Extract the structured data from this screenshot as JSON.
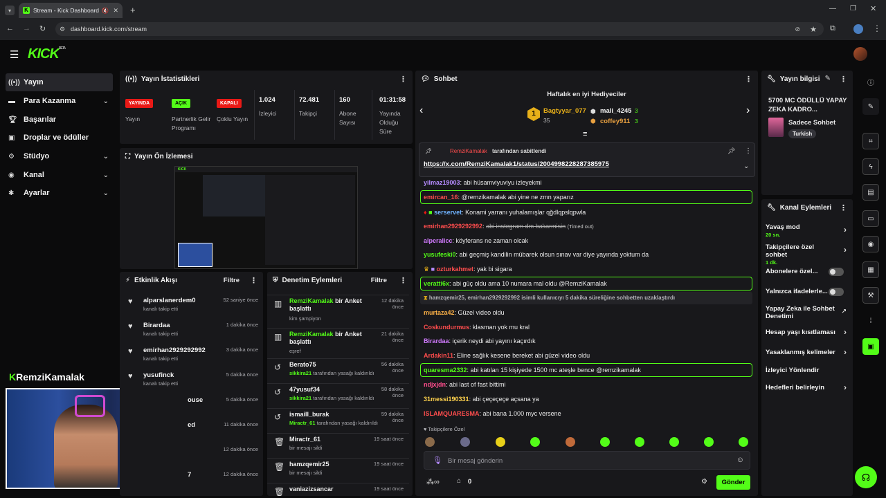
{
  "browser": {
    "tab_title": "Stream - Kick Dashboard",
    "url": "dashboard.kick.com/stream"
  },
  "brand": {
    "logo": "KICK",
    "beta": "BETA",
    "accent": "#53fc18"
  },
  "sidebar": {
    "items": [
      {
        "label": "Yayın",
        "icon": "stream-icon",
        "active": true
      },
      {
        "label": "Para Kazanma",
        "icon": "money-icon",
        "chevron": true
      },
      {
        "label": "Başarılar",
        "icon": "trophy-icon"
      },
      {
        "label": "Droplar ve ödüller",
        "icon": "gift-icon"
      },
      {
        "label": "Stüdyo",
        "icon": "gear-icon",
        "chevron": true
      },
      {
        "label": "Kanal",
        "icon": "broadcast-icon",
        "chevron": true
      },
      {
        "label": "Ayarlar",
        "icon": "settings-icon",
        "chevron": true
      }
    ],
    "channel_name": "RemziKamalak"
  },
  "stats": {
    "title": "Yayın İstatistikleri",
    "items": [
      {
        "badge": "YAYINDA",
        "label": "Yayın"
      },
      {
        "badge": "AÇIK",
        "label": "Partnerlik Gelir Programı"
      },
      {
        "badge": "KAPALI",
        "label": "Çoklu Yayın"
      },
      {
        "value": "1.024",
        "label": "İzleyici"
      },
      {
        "value": "72.481",
        "label": "Takipçi"
      },
      {
        "value": "160",
        "label": "Abone Sayısı"
      },
      {
        "value": "01:31:58",
        "label": "Yayında Olduğu Süre"
      }
    ]
  },
  "preview": {
    "title": "Yayın Ön İzlemesi"
  },
  "activity": {
    "title": "Etkinlik Akışı",
    "filter": "Filtre",
    "items": [
      {
        "name": "alparslanerdem0",
        "sub": "kanalı takip etti",
        "time": "52 saniye önce"
      },
      {
        "name": "Birardaa",
        "sub": "kanalı takip etti",
        "time": "1 dakika önce"
      },
      {
        "name": "emirhan2929292992",
        "sub": "kanalı takip etti",
        "time": "3 dakika önce"
      },
      {
        "name": "yusufinck",
        "sub": "kanalı takip etti",
        "time": "5 dakika önce"
      },
      {
        "name": "ouse",
        "sub": "",
        "time": "5 dakika önce"
      },
      {
        "name": "ed",
        "sub": "",
        "time": "11 dakika önce"
      },
      {
        "name": "",
        "sub": "",
        "time": "12 dakika önce"
      },
      {
        "name": "7",
        "sub": "",
        "time": "12 dakika önce"
      }
    ]
  },
  "moderation": {
    "title": "Denetim Eylemleri",
    "filter": "Filtre",
    "items": [
      {
        "icon": "poll-icon",
        "name": "RemziKamalak",
        "action": "bir Anket başlattı",
        "sub": "kim şampiyon",
        "time": "12 dakika önce"
      },
      {
        "icon": "poll-icon",
        "name": "RemziKamalak",
        "action": "bir Anket başlattı",
        "sub": "eşref",
        "time": "21 dakika önce"
      },
      {
        "icon": "undo-icon",
        "name": "Berato75",
        "by": "sikkira21",
        "sub": "tarafından yasağı kaldırıldı",
        "time": "56 dakika önce"
      },
      {
        "icon": "undo-icon",
        "name": "47yusuf34",
        "by": "sikkira21",
        "sub": "tarafından yasağı kaldırıldı",
        "time": "58 dakika önce"
      },
      {
        "icon": "undo-icon",
        "name": "ismaill_burak",
        "by": "Miractr_61",
        "sub": "tarafından yasağı kaldırıldı",
        "time": "59 dakika önce"
      },
      {
        "icon": "trash-icon",
        "name": "Miractr_61",
        "sub": "bir mesajı sildi",
        "time": "19 saat önce"
      },
      {
        "icon": "trash-icon",
        "name": "hamzqemir25",
        "sub": "bir mesajı sildi",
        "time": "19 saat önce"
      },
      {
        "icon": "trash-icon",
        "name": "vaniazizsancar",
        "sub": "",
        "time": "19 saat önce"
      }
    ]
  },
  "chat": {
    "title": "Sohbet",
    "gifters_title": "Haftalık en iyi Hediyeciler",
    "gifters": [
      {
        "rank": "1",
        "name": "Bagtyyar_077",
        "count": "35"
      },
      {
        "rank": "2",
        "name": "mali_4245",
        "count": "3"
      },
      {
        "rank": "3",
        "name": "coffey911",
        "count": "3"
      }
    ],
    "pinned_by": "RemziKamalak",
    "pinned_label": "tarafından sabitlendi",
    "pinned_link": "https://x.com/RemziKamalak1/status/2004998228287385975",
    "messages": [
      {
        "user": "yilmaz19003",
        "color": "#b68cff",
        "text": "abi hüsamviyuviyu izleyekmi"
      },
      {
        "user": "emircan_16",
        "color": "#ff4d4d",
        "text": "@remzikamalak abi yine ne zmn yaparız",
        "highlight": true
      },
      {
        "user": "serservet",
        "color": "#6fb3ff",
        "text": "Konami yarranı yuhalamışlar qğdlqpslqpwla"
      },
      {
        "user": "emirhan2929292992",
        "color": "#ff4d4d",
        "text": "abi instegram dm bakarmisin",
        "note": "(Timed out)",
        "strike": true
      },
      {
        "user": "alperalicc",
        "color": "#d27bff",
        "text": "köyferans ne zaman olcak"
      },
      {
        "user": "yusufeski0",
        "color": "#53fc18",
        "text": "abi geçmiş kandilin mübarek olsun sınav var diye yayında yoktum da"
      },
      {
        "user": "ozturkahmet",
        "color": "#ff4d4d",
        "text": "yak bi sigara"
      },
      {
        "user": "veratti6x",
        "color": "#53fc18",
        "text": "abi güç oldu ama 10 numara mal oldu @RemziKamalak",
        "highlight": true
      },
      {
        "system": "hamzqemir25, emirhan2929292992 isimli kullanıcıyı 5 dakika süreliğine sohbetten uzaklaştırdı"
      },
      {
        "user": "murtaza42",
        "color": "#ffb347",
        "text": "Güzel video oldu"
      },
      {
        "user": "Coskundurmus",
        "color": "#ff4d4d",
        "text": "klasman yok mu kral"
      },
      {
        "user": "Birardaa",
        "color": "#d27bff",
        "text": "içerik neydi abi yayını kaçırdık"
      },
      {
        "user": "Ardakin11",
        "color": "#ff4d4d",
        "text": "Eline sağlık kesene bereket abi güzel video oldu"
      },
      {
        "user": "quaresma2332",
        "color": "#53fc18",
        "text": "abi katılan 15 kişiyede 1500 mc ateşle bence @remzikamalak",
        "highlight": true
      },
      {
        "user": "ndjxjdn",
        "color": "#ff4d8d",
        "text": "abi last of fast bittimi"
      },
      {
        "user": "31messi190331",
        "color": "#ffd24d",
        "text": "abi çeçeçeçe açsana ya"
      },
      {
        "user": "ISLAMQUARESMA",
        "color": "#ff4d4d",
        "text": "abi bana 1.000 myc versene"
      }
    ],
    "emote_label": "Takipçilere Özel",
    "input_placeholder": "Bir mesaj gönderin",
    "points": "0",
    "send_label": "Gönder"
  },
  "stream_info": {
    "title": "Yayın bilgisi",
    "stream_title": "5700 MC ÖDÜLLÜ YAPAY ZEKA KADRO...",
    "category": "Sadece Sohbet",
    "tag": "Turkish"
  },
  "channel_actions": {
    "title": "Kanal Eylemleri",
    "items": [
      {
        "label": "Yavaş mod",
        "sub": "20 sn.",
        "control": "chevron"
      },
      {
        "label": "Takipçilere özel sohbet",
        "sub": "1 dk.",
        "control": "chevron"
      },
      {
        "label": "Abonelere özel...",
        "control": "toggle"
      },
      {
        "label": "Yalnızca ifadelerle...",
        "control": "toggle"
      },
      {
        "label": "Yapay Zeka ile Sohbet Denetimi",
        "control": "external"
      },
      {
        "label": "Hesap yaşı kısıtlaması",
        "control": "chevron"
      },
      {
        "label": "Yasaklanmış kelimeler",
        "control": "chevron"
      },
      {
        "label": "İzleyici Yönlendir",
        "control": "none"
      },
      {
        "label": "Hedefleri belirleyin",
        "control": "chevron"
      }
    ]
  }
}
